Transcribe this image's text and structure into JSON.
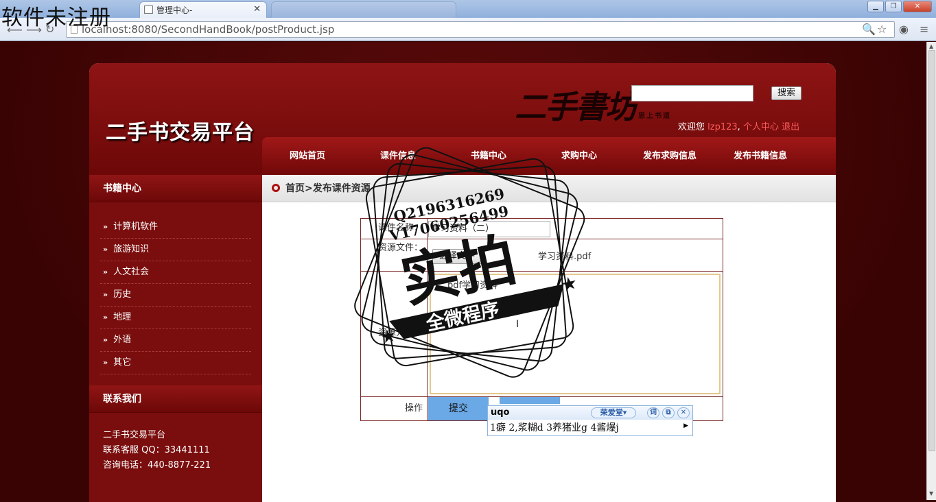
{
  "overlay_watermark": "软件未注册",
  "browser": {
    "active_tab": "管理中心-",
    "url": "localhost:8080/SecondHandBook/postProduct.jsp"
  },
  "header": {
    "brand": "二手书交易平台",
    "logo_art": "二手書坊",
    "logo_slogan": "思上书道",
    "search_button": "搜索",
    "welcome_prefix": "欢迎您",
    "username": "lzp123",
    "separator": ",",
    "profile_link": "个人中心",
    "logout_link": "退出"
  },
  "nav": [
    "网站首页",
    "课件信息",
    "书籍中心",
    "求购中心",
    "发布求购信息",
    "发布书籍信息"
  ],
  "sidebar": {
    "title": "书籍中心",
    "items": [
      "计算机软件",
      "旅游知识",
      "人文社会",
      "历史",
      "地理",
      "外语",
      "其它"
    ],
    "contact_title": "联系我们",
    "contact_lines": [
      "二手书交易平台",
      "联系客服 QQ：33441111",
      "咨询电话：440-8877-221"
    ]
  },
  "breadcrumb": "首页>发布课件资源",
  "form": {
    "title_label": "课件名称：",
    "title_value": "学习资料（二）",
    "file_label": "资源文件：",
    "file_button": "选择文件",
    "file_name": "学习资料.pdf",
    "desc_label": "资源介绍：",
    "desc_value": "pdf学习资料",
    "action_label": "操作",
    "submit_label": "提交"
  },
  "stamp": {
    "qq": "Q2196316269",
    "phone": "V17060256499",
    "big": "实拍",
    "banner": "全微程序"
  },
  "ime": {
    "pinyin": "uqo",
    "skin_label": "荣爱堂▾",
    "btn_dict": "词",
    "btn_copy": "⧉",
    "btn_close": "✕",
    "candidates": "1癖 2,浆糊d 3养猪业g 4酱爆j"
  }
}
